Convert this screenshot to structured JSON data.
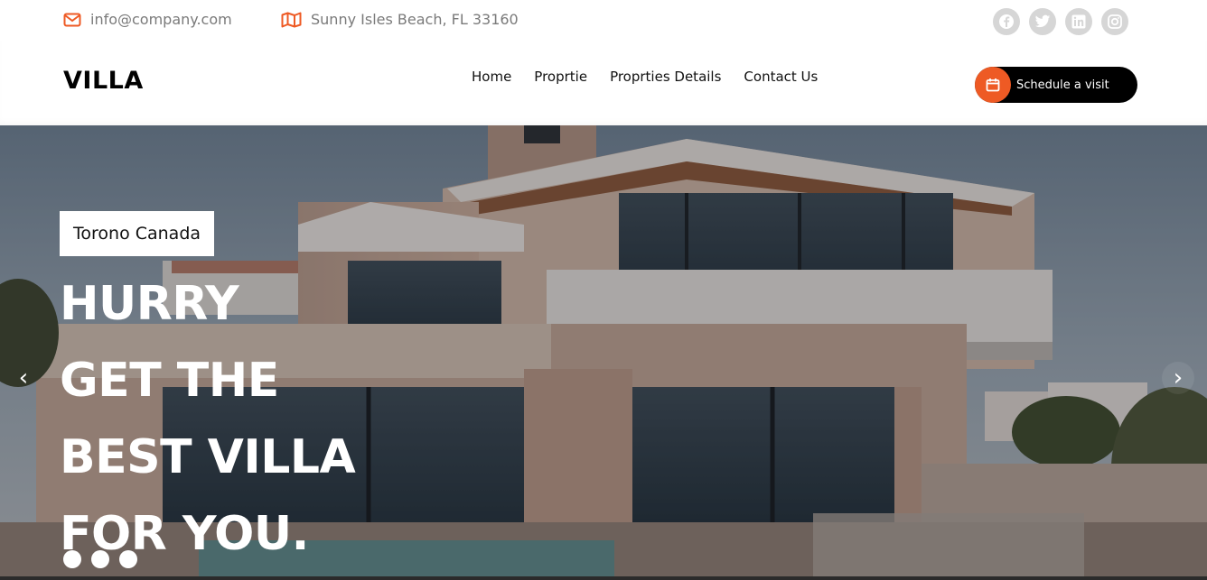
{
  "topbar": {
    "email": "info@company.com",
    "email_icon": "envelope-icon",
    "address": "Sunny Isles Beach, FL 33160",
    "address_icon": "map-icon",
    "socials": [
      "facebook-icon",
      "twitter-icon",
      "linkedin-icon",
      "instagram-icon"
    ]
  },
  "nav": {
    "logo": "VILLA",
    "menu": [
      "Home",
      "Proprtie",
      "Proprties Details",
      "Contact Us"
    ],
    "cta_label": "Schedule a visit",
    "cta_icon": "calendar-icon"
  },
  "hero": {
    "tag": "Torono Canada",
    "headline": [
      "HURRY",
      "GET THE",
      "BEST VILLA",
      "FOR YOU."
    ],
    "prev_icon": "chevron-left-icon",
    "next_icon": "chevron-right-icon",
    "slide_count": 3
  },
  "colors": {
    "accent": "#ee5a24",
    "dark": "#000000",
    "muted_text": "#7a7a7a",
    "social_bg": "#d6d6d6"
  }
}
